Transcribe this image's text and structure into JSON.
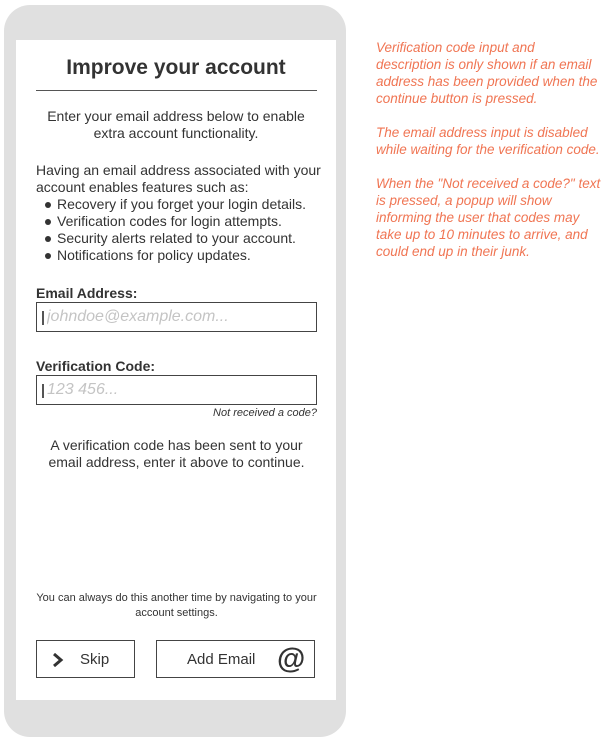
{
  "screen": {
    "title": "Improve your account",
    "intro": "Enter your email address below to enable extra account functionality.",
    "features_lead": "Having an email address associated with your account enables features such as:",
    "features": [
      "Recovery if you forget your login details.",
      "Verification codes for login attempts.",
      "Security alerts related to your account.",
      "Notifications for policy updates."
    ],
    "email": {
      "label": "Email Address:",
      "value": "",
      "placeholder": "johndoe@example.com..."
    },
    "verification": {
      "label": "Verification Code:",
      "value": "",
      "placeholder": "123 456...",
      "not_received_link": "Not received a code?"
    },
    "sent_message": "A verification code has been sent to your email address, enter it above to continue.",
    "later_note": "You can always do this another time by navigating to your account settings.",
    "buttons": {
      "skip_label": "Skip",
      "skip_icon": "chevron-right-icon",
      "add_email_label": "Add Email",
      "add_email_icon": "at-sign-icon",
      "add_email_glyph": "@"
    }
  },
  "annotations": [
    "Verification code input and description is only shown if an email address has been provided when the continue button is pressed.",
    "The email address input is disabled while waiting for the verification code.",
    "When the \"Not received a code?\" text is pressed, a popup will show informing the user that codes may take up to 10 minutes to arrive, and could end up in their junk."
  ],
  "colors": {
    "device_frame": "#e0e0e0",
    "text": "#333333",
    "annotation": "#f07553",
    "placeholder": "#c4c4c4"
  }
}
